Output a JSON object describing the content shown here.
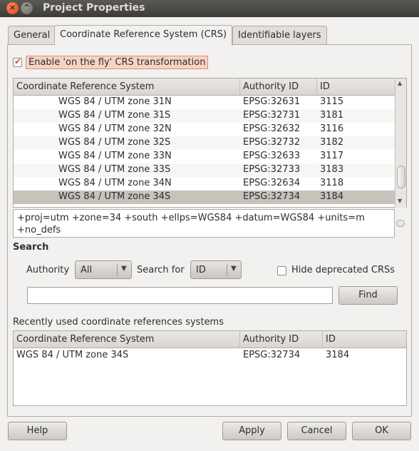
{
  "window": {
    "title": "Project Properties",
    "close_glyph": "×",
    "min_glyph": "^"
  },
  "tabs": [
    {
      "label": "General"
    },
    {
      "label": "Coordinate Reference System (CRS)"
    },
    {
      "label": "Identifiable layers"
    }
  ],
  "otf_checkbox": {
    "label": "Enable 'on the fly' CRS transformation",
    "checked": true
  },
  "crs_table": {
    "headers": [
      "Coordinate Reference System",
      "Authority ID",
      "ID"
    ],
    "rows": [
      {
        "name": "WGS 84 / UTM zone 31N",
        "authority": "EPSG:32631",
        "id": "3115"
      },
      {
        "name": "WGS 84 / UTM zone 31S",
        "authority": "EPSG:32731",
        "id": "3181"
      },
      {
        "name": "WGS 84 / UTM zone 32N",
        "authority": "EPSG:32632",
        "id": "3116"
      },
      {
        "name": "WGS 84 / UTM zone 32S",
        "authority": "EPSG:32732",
        "id": "3182"
      },
      {
        "name": "WGS 84 / UTM zone 33N",
        "authority": "EPSG:32633",
        "id": "3117"
      },
      {
        "name": "WGS 84 / UTM zone 33S",
        "authority": "EPSG:32733",
        "id": "3183"
      },
      {
        "name": "WGS 84 / UTM zone 34N",
        "authority": "EPSG:32634",
        "id": "3118"
      },
      {
        "name": "WGS 84 / UTM zone 34S",
        "authority": "EPSG:32734",
        "id": "3184",
        "selected": true
      }
    ]
  },
  "proj_string": {
    "line1": "+proj=utm +zone=34 +south +ellps=WGS84 +datum=WGS84 +units=m",
    "line2": "+no_defs"
  },
  "search": {
    "heading": "Search",
    "authority_label": "Authority",
    "authority_value": "All",
    "search_for_label": "Search for",
    "search_for_value": "ID",
    "hide_deprecated_label": "Hide deprecated CRSs",
    "hide_deprecated_checked": false,
    "input_value": "",
    "find_label": "Find"
  },
  "recent": {
    "heading": "Recently used coordinate references systems",
    "headers": [
      "Coordinate Reference System",
      "Authority ID",
      "ID"
    ],
    "rows": [
      {
        "name": "WGS 84 / UTM zone 34S",
        "authority": "EPSG:32734",
        "id": "3184"
      }
    ]
  },
  "buttons": {
    "help": "Help",
    "apply": "Apply",
    "cancel": "Cancel",
    "ok": "OK"
  },
  "colors": {
    "selected_row": "#c8c2bb",
    "checkbox_highlight": "#f5d3c5",
    "titlebar": "#3c3b37"
  }
}
